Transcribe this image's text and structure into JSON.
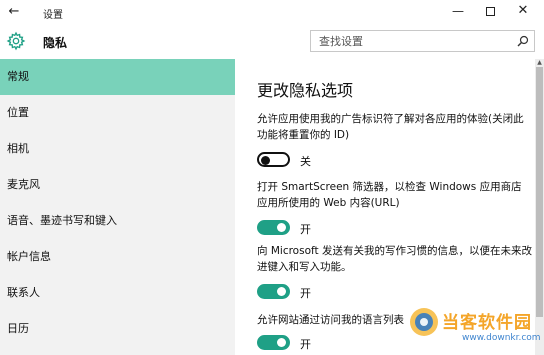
{
  "window": {
    "title": "设置",
    "back_glyph": "←",
    "minimize_glyph": "—",
    "close_glyph": "✕"
  },
  "header": {
    "title": "隐私",
    "icon": "gear-icon"
  },
  "search": {
    "placeholder": "查找设置",
    "icon": "search-icon"
  },
  "sidebar": {
    "items": [
      {
        "label": "常规",
        "active": true
      },
      {
        "label": "位置"
      },
      {
        "label": "相机"
      },
      {
        "label": "麦克风"
      },
      {
        "label": "语音、墨迹书写和键入"
      },
      {
        "label": "帐户信息"
      },
      {
        "label": "联系人"
      },
      {
        "label": "日历"
      }
    ]
  },
  "main": {
    "title": "更改隐私选项",
    "settings": [
      {
        "description": "允许应用使用我的广告标识符了解对各应用的体验(关闭此功能将重置你的 ID)",
        "state": "off",
        "state_label": "关"
      },
      {
        "description": "打开 SmartScreen 筛选器，以检查 Windows 应用商店应用所使用的 Web 内容(URL)",
        "state": "on",
        "state_label": "开"
      },
      {
        "description": "向 Microsoft 发送有关我的写作习惯的信息，以便在未来改进键入和写入功能。",
        "state": "on",
        "state_label": "开"
      },
      {
        "description": "允许网站通过访问我的语言列表",
        "state": "on",
        "state_label": "开"
      }
    ]
  },
  "watermark": {
    "brand": "当客软件园",
    "url": "www.downkr.com"
  },
  "colors": {
    "accent": "#79d2ba",
    "toggle_on": "#1fa086",
    "sidebar_bg": "#f2f2f2"
  }
}
